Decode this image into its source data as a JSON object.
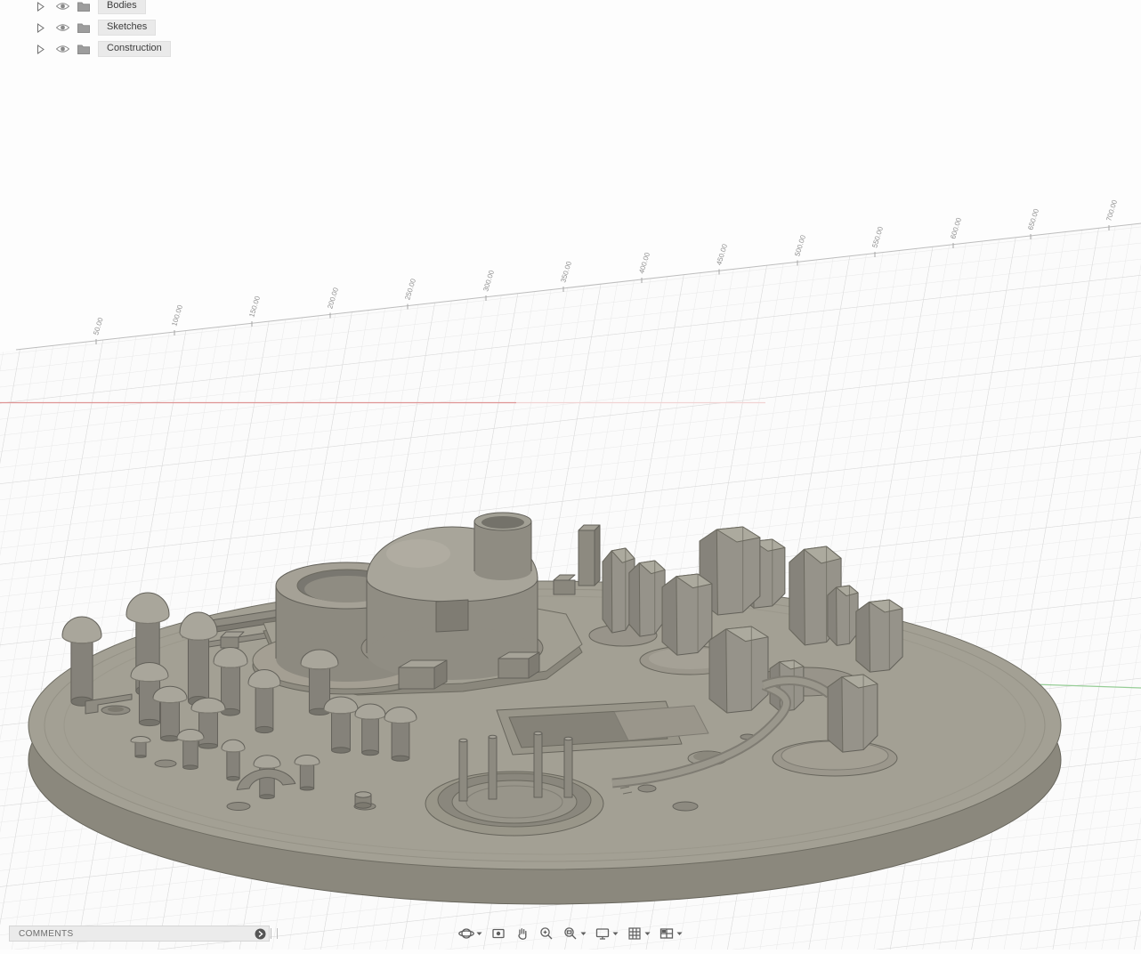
{
  "browser": {
    "items": [
      {
        "label": "Bodies",
        "icon": "folder",
        "state": "collapsed",
        "visible": true
      },
      {
        "label": "Sketches",
        "icon": "folder",
        "state": "collapsed",
        "visible": true
      },
      {
        "label": "Construction",
        "icon": "folder",
        "state": "collapsed",
        "visible": true
      }
    ]
  },
  "ruler": {
    "ticks": [
      "50.00",
      "100.00",
      "150.00",
      "200.00",
      "250.00",
      "300.00",
      "350.00",
      "400.00",
      "450.00",
      "500.00",
      "550.00",
      "600.00",
      "650.00",
      "700.00"
    ]
  },
  "axes": {
    "x_color": "#de9494",
    "y_color": "#96cd96"
  },
  "comments": {
    "label": "COMMENTS"
  },
  "nav_toolbar": {
    "items": [
      {
        "name": "orbit",
        "caret": true
      },
      {
        "name": "look-at",
        "caret": false
      },
      {
        "name": "pan",
        "caret": false
      },
      {
        "name": "zoom",
        "caret": false
      },
      {
        "name": "zoom-window",
        "caret": true
      },
      {
        "name": "display-settings",
        "caret": true
      },
      {
        "name": "grid-and-snaps",
        "caret": true
      },
      {
        "name": "viewports",
        "caret": true
      }
    ]
  },
  "model": {
    "color_top": "#a3a094",
    "color_side": "#8b887d",
    "outline": "#67655c"
  },
  "grid": {
    "minor_color": "#e8e8e8",
    "major_color": "#d9d9d9"
  }
}
